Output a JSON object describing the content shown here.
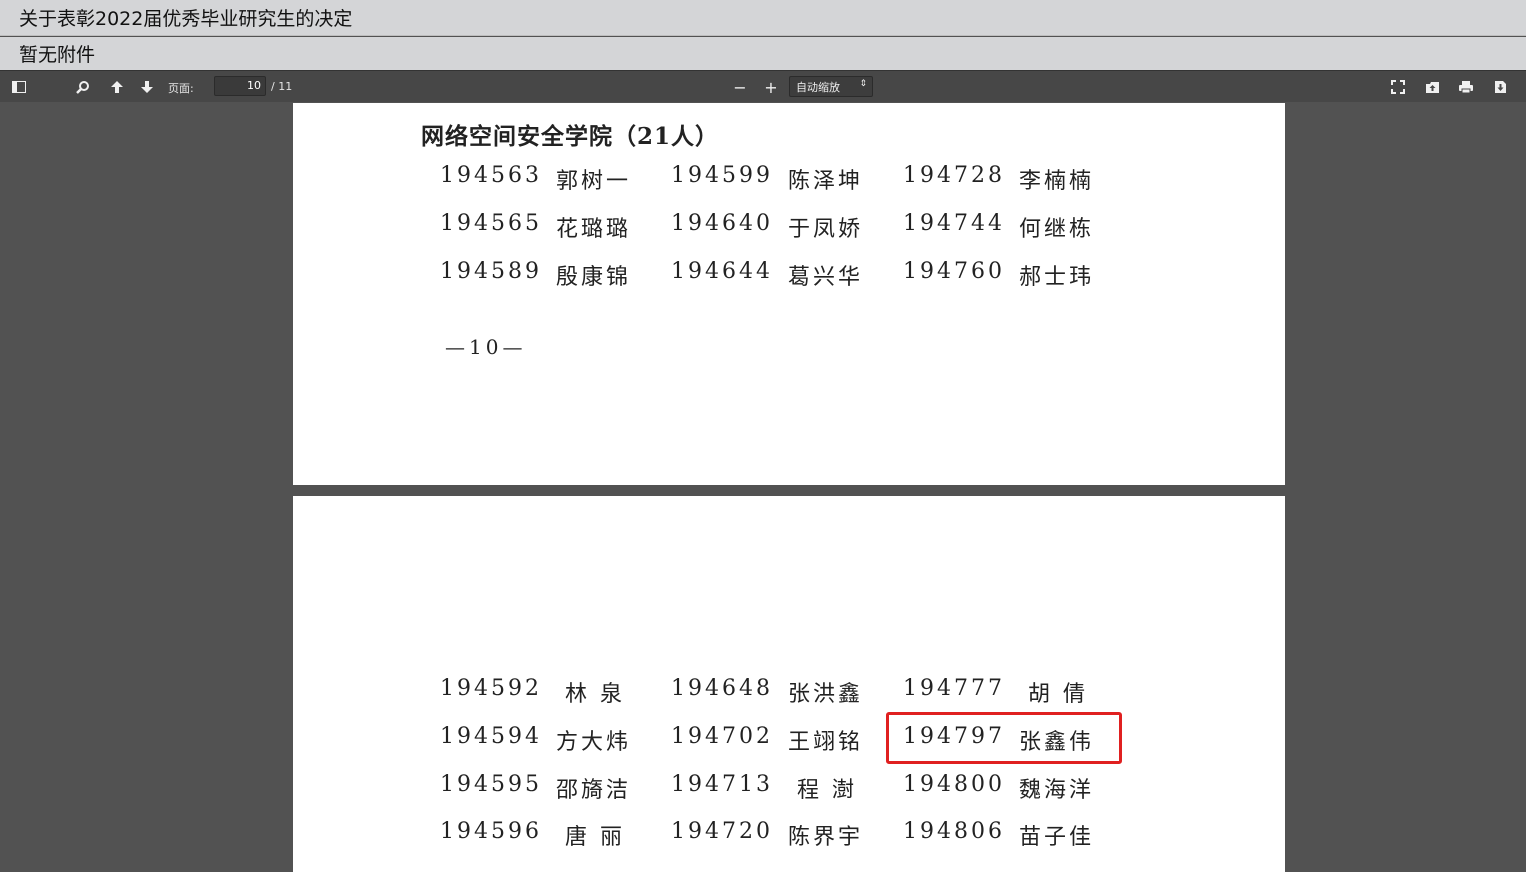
{
  "header": {
    "title": "关于表彰2022届优秀毕业研究生的决定",
    "attachment_note": "暂无附件"
  },
  "toolbar": {
    "page_label": "页面:",
    "current_page": "10",
    "total_pages": "/ 11",
    "zoom_out": "−",
    "zoom_in": "+",
    "zoom_value": "自动缩放",
    "icons": [
      "sidebar-toggle-icon",
      "search-icon",
      "previous-page-icon",
      "next-page-icon",
      "fullscreen-icon",
      "open-file-icon",
      "print-icon",
      "download-icon"
    ]
  },
  "page10": {
    "section_title": "网络空间安全学院（21人）",
    "rows": [
      [
        "194563",
        "郭树一",
        "194599",
        "陈泽坤",
        "194728",
        "李楠楠"
      ],
      [
        "194565",
        "花璐璐",
        "194640",
        "于凤娇",
        "194744",
        "何继栋"
      ],
      [
        "194589",
        "殷康锦",
        "194644",
        "葛兴华",
        "194760",
        "郝士玮"
      ]
    ],
    "page_number": "—10—"
  },
  "page11": {
    "rows": [
      [
        "194592",
        "林 泉",
        "194648",
        "张洪鑫",
        "194777",
        "胡 倩"
      ],
      [
        "194594",
        "方大炜",
        "194702",
        "王翊铭",
        "194797",
        "张鑫伟"
      ],
      [
        "194595",
        "邵旖洁",
        "194713",
        "程 澍",
        "194800",
        "魏海洋"
      ],
      [
        "194596",
        "唐 丽",
        "194720",
        "陈界宇",
        "194806",
        "苗子佳"
      ]
    ]
  },
  "colors": {
    "highlight": "#e02020",
    "toolbar_bg": "#474747",
    "viewer_bg": "#525252"
  }
}
